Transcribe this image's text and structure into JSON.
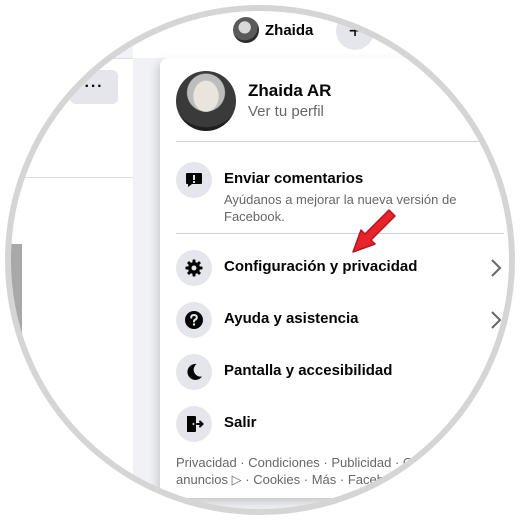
{
  "header": {
    "profile_name": "Zhaida",
    "plus_symbol": "+",
    "more_label": "···"
  },
  "menu": {
    "profile": {
      "name": "Zhaida AR",
      "subtitle": "Ver tu perfil"
    },
    "feedback": {
      "label": "Enviar comentarios",
      "description": "Ayúdanos a mejorar la nueva versión de Facebook.",
      "icon": "feedback-exclamation-icon"
    },
    "items": [
      {
        "label": "Configuración y privacidad",
        "icon": "gear-icon",
        "has_chevron": true
      },
      {
        "label": "Ayuda y asistencia",
        "icon": "question-icon",
        "has_chevron": true
      },
      {
        "label": "Pantalla y accesibilidad",
        "icon": "moon-icon",
        "has_chevron": true
      },
      {
        "label": "Salir",
        "icon": "logout-door-icon",
        "has_chevron": false
      }
    ],
    "footer": {
      "line1": "Privacidad · Condiciones · Publicidad · O",
      "line2": "anuncios ▷ · Cookies · Más · Faceb"
    }
  },
  "colors": {
    "accent_arrow": "#e8232a",
    "icon_bg": "#e4e6eb",
    "text_primary": "#050505",
    "text_secondary": "#65676b"
  }
}
